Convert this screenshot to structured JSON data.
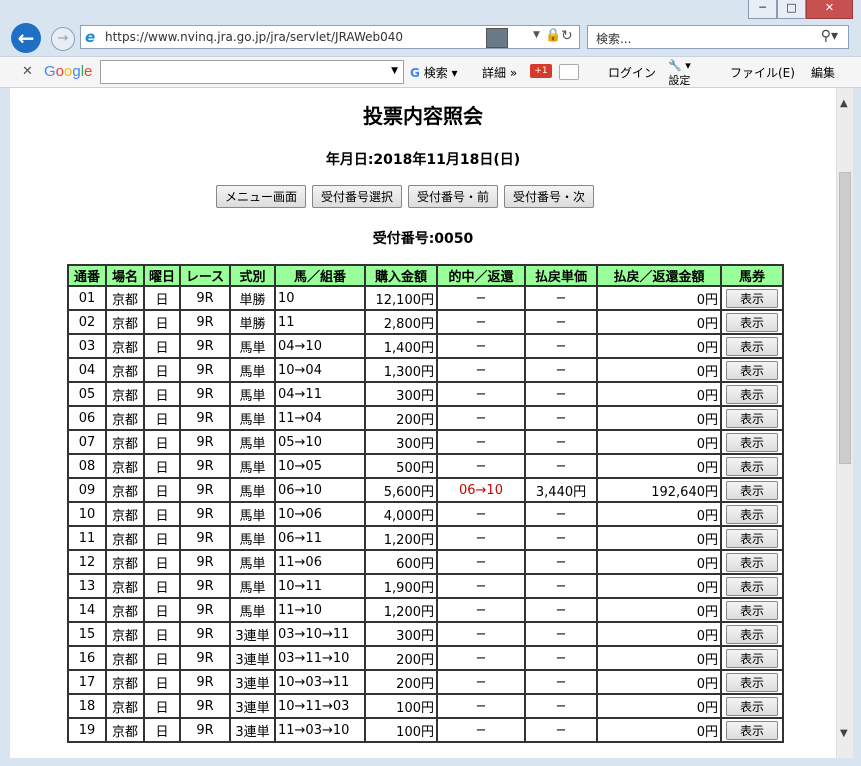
{
  "browser": {
    "url": "https://www.nvinq.jra.go.jp/jra/servlet/JRAWeb040",
    "search_placeholder": "検索...",
    "google_label": "Google",
    "google_search": "検索",
    "detail": "詳細 »",
    "plus_badge": "+1",
    "login": "ログイン",
    "settings": "設定",
    "file_menu": "ファイル(E)",
    "edit_menu": "編集"
  },
  "page": {
    "title": "投票内容照会",
    "date": "年月日:2018年11月18日(日)",
    "buttons": [
      "メニュー画面",
      "受付番号選択",
      "受付番号・前",
      "受付番号・次"
    ],
    "ticket": "受付番号:0050"
  },
  "table": {
    "headers": [
      "通番",
      "場名",
      "曜日",
      "レース",
      "式別",
      "馬／組番",
      "購入金額",
      "的中／返還",
      "払戻単価",
      "払戻／返還金額",
      "馬券"
    ],
    "button_label": "表示",
    "rows": [
      [
        "01",
        "京都",
        "日",
        "9R",
        "単勝",
        "10",
        "12,100円",
        "−",
        "−",
        "0円"
      ],
      [
        "02",
        "京都",
        "日",
        "9R",
        "単勝",
        "11",
        "2,800円",
        "−",
        "−",
        "0円"
      ],
      [
        "03",
        "京都",
        "日",
        "9R",
        "馬単",
        "04→10",
        "1,400円",
        "−",
        "−",
        "0円"
      ],
      [
        "04",
        "京都",
        "日",
        "9R",
        "馬単",
        "10→04",
        "1,300円",
        "−",
        "−",
        "0円"
      ],
      [
        "05",
        "京都",
        "日",
        "9R",
        "馬単",
        "04→11",
        "300円",
        "−",
        "−",
        "0円"
      ],
      [
        "06",
        "京都",
        "日",
        "9R",
        "馬単",
        "11→04",
        "200円",
        "−",
        "−",
        "0円"
      ],
      [
        "07",
        "京都",
        "日",
        "9R",
        "馬単",
        "05→10",
        "300円",
        "−",
        "−",
        "0円"
      ],
      [
        "08",
        "京都",
        "日",
        "9R",
        "馬単",
        "10→05",
        "500円",
        "−",
        "−",
        "0円"
      ],
      [
        "09",
        "京都",
        "日",
        "9R",
        "馬単",
        "06→10",
        "5,600円",
        "06→10",
        "3,440円",
        "192,640円"
      ],
      [
        "10",
        "京都",
        "日",
        "9R",
        "馬単",
        "10→06",
        "4,000円",
        "−",
        "−",
        "0円"
      ],
      [
        "11",
        "京都",
        "日",
        "9R",
        "馬単",
        "06→11",
        "1,200円",
        "−",
        "−",
        "0円"
      ],
      [
        "12",
        "京都",
        "日",
        "9R",
        "馬単",
        "11→06",
        "600円",
        "−",
        "−",
        "0円"
      ],
      [
        "13",
        "京都",
        "日",
        "9R",
        "馬単",
        "10→11",
        "1,900円",
        "−",
        "−",
        "0円"
      ],
      [
        "14",
        "京都",
        "日",
        "9R",
        "馬単",
        "11→10",
        "1,200円",
        "−",
        "−",
        "0円"
      ],
      [
        "15",
        "京都",
        "日",
        "9R",
        "3連単",
        "03→10→11",
        "300円",
        "−",
        "−",
        "0円"
      ],
      [
        "16",
        "京都",
        "日",
        "9R",
        "3連単",
        "03→11→10",
        "200円",
        "−",
        "−",
        "0円"
      ],
      [
        "17",
        "京都",
        "日",
        "9R",
        "3連単",
        "10→03→11",
        "200円",
        "−",
        "−",
        "0円"
      ],
      [
        "18",
        "京都",
        "日",
        "9R",
        "3連単",
        "10→11→03",
        "100円",
        "−",
        "−",
        "0円"
      ],
      [
        "19",
        "京都",
        "日",
        "9R",
        "3連単",
        "11→03→10",
        "100円",
        "−",
        "−",
        "0円"
      ]
    ]
  }
}
